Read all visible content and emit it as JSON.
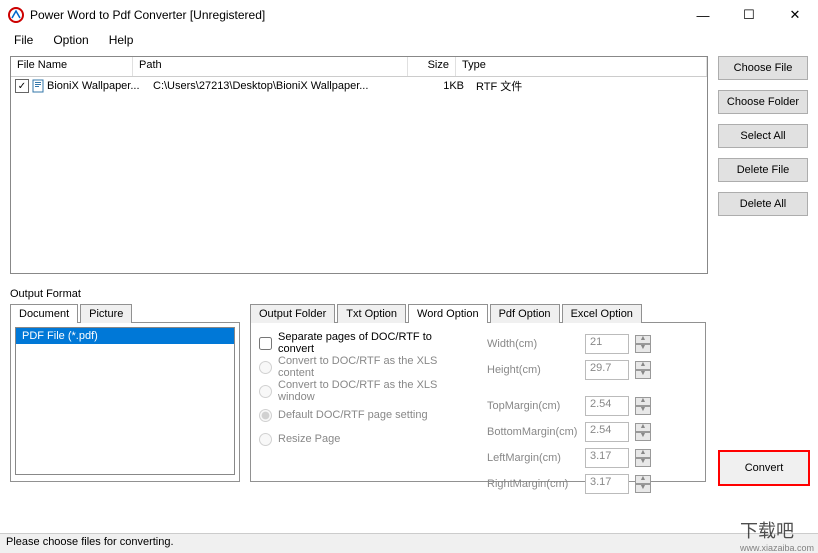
{
  "window": {
    "title": "Power Word to Pdf Converter [Unregistered]"
  },
  "menu": {
    "file": "File",
    "option": "Option",
    "help": "Help"
  },
  "table": {
    "headers": {
      "name": "File Name",
      "path": "Path",
      "size": "Size",
      "type": "Type"
    },
    "rows": [
      {
        "checked": "✓",
        "name": "BioniX Wallpaper...",
        "path": "C:\\Users\\27213\\Desktop\\BioniX Wallpaper...",
        "size": "1KB",
        "type": "RTF 文件"
      }
    ]
  },
  "buttons": {
    "choose_file": "Choose File",
    "choose_folder": "Choose Folder",
    "select_all": "Select All",
    "delete_file": "Delete File",
    "delete_all": "Delete All",
    "convert": "Convert"
  },
  "output_format_label": "Output Format",
  "format_tabs": {
    "document": "Document",
    "picture": "Picture"
  },
  "format_list": {
    "item1": "PDF File  (*.pdf)"
  },
  "option_tabs": {
    "output_folder": "Output Folder",
    "txt": "Txt Option",
    "word": "Word Option",
    "pdf": "Pdf Option",
    "excel": "Excel Option"
  },
  "word_opts": {
    "separate": "Separate pages of DOC/RTF to convert",
    "xls_content": "Convert to DOC/RTF as the XLS content",
    "xls_window": "Convert to DOC/RTF as the XLS window",
    "default": "Default DOC/RTF page setting",
    "resize": "Resize Page"
  },
  "dims": {
    "width_label": "Width(cm)",
    "width": "21",
    "height_label": "Height(cm)",
    "height": "29.7",
    "top_label": "TopMargin(cm)",
    "top": "2.54",
    "bottom_label": "BottomMargin(cm)",
    "bottom": "2.54",
    "left_label": "LeftMargin(cm)",
    "left": "3.17",
    "right_label": "RightMargin(cm)",
    "right": "3.17"
  },
  "status": "Please choose files for converting.",
  "watermark": {
    "main": "下载吧",
    "sub": "www.xiazaiba.com"
  }
}
